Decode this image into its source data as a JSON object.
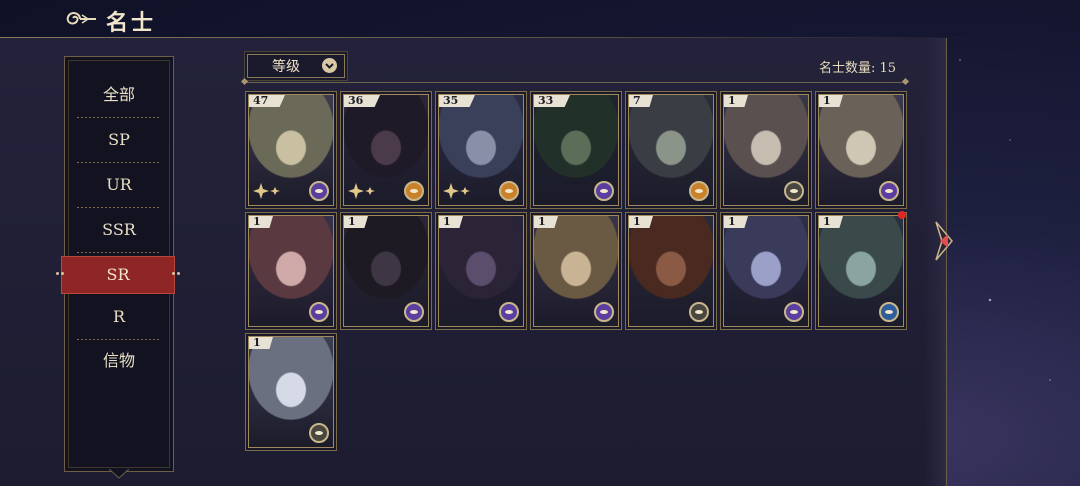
{
  "header": {
    "title": "名士"
  },
  "sidebar": {
    "items": [
      {
        "label": "全部",
        "active": false
      },
      {
        "label": "SP",
        "active": false
      },
      {
        "label": "UR",
        "active": false
      },
      {
        "label": "SSR",
        "active": false
      },
      {
        "label": "SR",
        "active": true
      },
      {
        "label": "R",
        "active": false
      },
      {
        "label": "信物",
        "active": false
      }
    ]
  },
  "toolbar": {
    "sort_label": "等级",
    "count_label": "名士数量: 15"
  },
  "cards": [
    {
      "level": "47",
      "badge": "purple",
      "stars": true
    },
    {
      "level": "36",
      "badge": "orange",
      "stars": true
    },
    {
      "level": "35",
      "badge": "orange",
      "stars": true
    },
    {
      "level": "33",
      "badge": "purple",
      "stars": false
    },
    {
      "level": "7",
      "badge": "orange",
      "stars": false
    },
    {
      "level": "1",
      "badge": "gray",
      "stars": false
    },
    {
      "level": "1",
      "badge": "purple",
      "stars": false
    },
    {
      "level": "1",
      "badge": "purple",
      "stars": false
    },
    {
      "level": "1",
      "badge": "purple",
      "stars": false
    },
    {
      "level": "1",
      "badge": "purple",
      "stars": false
    },
    {
      "level": "1",
      "badge": "purple",
      "stars": false
    },
    {
      "level": "1",
      "badge": "gray",
      "stars": false
    },
    {
      "level": "1",
      "badge": "purple",
      "stars": false
    },
    {
      "level": "1",
      "badge": "blue",
      "stars": false,
      "notification": true
    },
    {
      "level": "1",
      "badge": "gray",
      "stars": false
    }
  ],
  "colors": {
    "accent_gold": "#a08a5c",
    "active_tab": "#8e2626",
    "badge_purple": "#5a3fa0",
    "badge_orange": "#c9812a",
    "badge_gray": "#4a4640",
    "badge_blue": "#2f5f9a",
    "notification": "#e02828"
  }
}
